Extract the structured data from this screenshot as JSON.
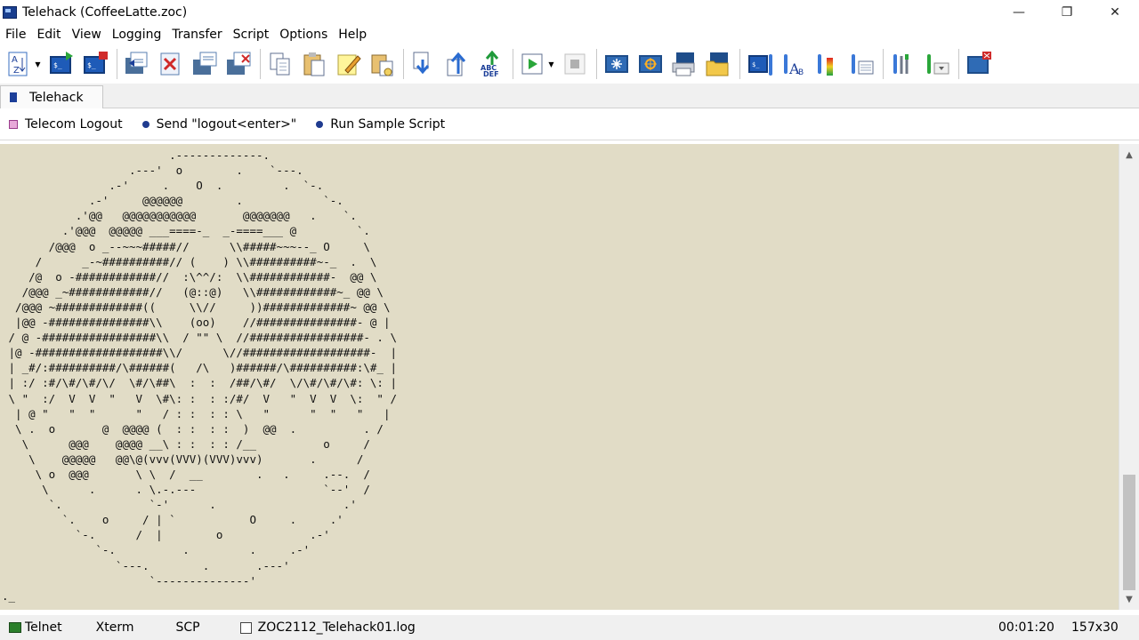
{
  "window": {
    "title": "Telehack (CoffeeLatte.zoc)",
    "minimize": "—",
    "restore": "❐",
    "close": "✕"
  },
  "menu": [
    "File",
    "Edit",
    "View",
    "Logging",
    "Transfer",
    "Script",
    "Options",
    "Help"
  ],
  "tabs": [
    {
      "label": "Telehack"
    }
  ],
  "buttonbar": {
    "items": [
      "Telecom Logout",
      "Send \"logout<enter>\"",
      "Run Sample Script"
    ]
  },
  "terminal": {
    "lines": [
      "                         .-------------.",
      "                   .---'  o        .    `---.",
      "                .-'     .    O  .         .  `-.",
      "             .-'     @@@@@@        .            `-.",
      "           .'@@   @@@@@@@@@@@       @@@@@@@   .    `.",
      "         .'@@@  @@@@@ ___====-_  _-====___ @         `.",
      "       /@@@  o _--~~~#####//      \\\\#####~~~--_ O     \\",
      "     /      _-~##########// (    ) \\\\##########~-_  .  \\",
      "    /@  o -############//  :\\^^/:  \\\\############-  @@ \\",
      "   /@@@ _~############//   (@::@)   \\\\############~_ @@ \\",
      "  /@@@ ~#############((     \\\\//     ))#############~ @@ \\",
      "  |@@ -###############\\\\    (oo)    //###############- @ |",
      " / @ -#################\\\\  / \"\" \\  //#################- . \\",
      " |@ -###################\\\\/      \\//###################-  |",
      " | _#/:##########/\\######(   /\\   )######/\\##########:\\#_ |",
      " | :/ :#/\\#/\\#/\\/  \\#/\\##\\  :  :  /##/\\#/  \\/\\#/\\#/\\#: \\: |",
      " \\ \"  :/  V  V  \"   V  \\#\\: :  : :/#/  V   \"  V  V  \\:  \" /",
      "  | @ \"   \"  \"      \"   / : :  : : \\   \"      \"  \"   \"   |",
      "  \\ .  o       @  @@@@ (  : :  : :  )  @@  .          . /",
      "   \\      @@@    @@@@ __\\ : :  : : /__          o     /",
      "    \\    @@@@@   @@\\@(vvv(VVV)(VVV)vvv)       .      /",
      "     \\ o  @@@       \\ \\  /  __        .   .     .--.  /",
      "      \\      .      . \\.-.---                   `--'  /",
      "       `.             `-'      .                   .'",
      "         `.    o     / | `           O     .     .'",
      "           `-.      /  |        o             .-'",
      "              `-.          .         .     .-'",
      "                 `---.        .       .---'",
      "                      `--------------'",
      "._"
    ]
  },
  "statusbar": {
    "protocol": "Telnet",
    "emulation": "Xterm",
    "transfer": "SCP",
    "logfile": "ZOC2112_Telehack01.log",
    "time": "00:01:20",
    "size": "157x30"
  },
  "colors": {
    "terminal_bg": "#e1dcc6",
    "accent": "#1f3b8f"
  }
}
